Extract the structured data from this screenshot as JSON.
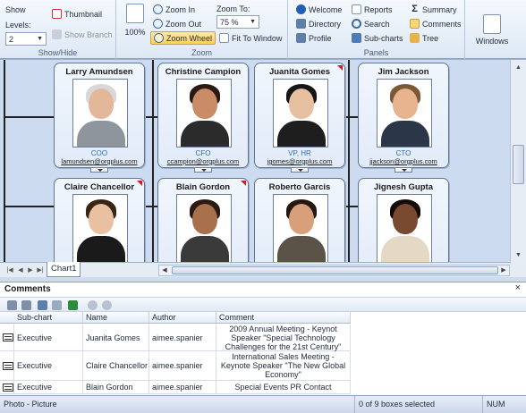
{
  "ribbon": {
    "show_hide": {
      "show_label": "Show",
      "levels_label": "Levels:",
      "show_value": "2",
      "levels_value": "2",
      "thumbnail_label": "Thumbnail",
      "show_branch_label": "Show Branch",
      "group_label": "Show/Hide"
    },
    "zoom": {
      "zoom_100_label": "100%",
      "zoom_in_label": "Zoom In",
      "zoom_out_label": "Zoom Out",
      "zoom_wheel_label": "Zoom Wheel",
      "zoom_to_label": "Zoom To:",
      "zoom_to_value": "75 %",
      "fit_to_window_label": "Fit To Window",
      "group_label": "Zoom"
    },
    "panels": {
      "welcome_label": "Welcome",
      "directory_label": "Directory",
      "profile_label": "Profile",
      "reports_label": "Reports",
      "search_label": "Search",
      "subcharts_label": "Sub-charts",
      "summary_label": "Summary",
      "comments_label": "Comments",
      "tree_label": "Tree",
      "group_label": "Panels"
    },
    "windows_label": "Windows"
  },
  "chart": {
    "cards": [
      {
        "name": "Larry Amundsen",
        "title": "COO",
        "email": "lamundsen@orgplus.com",
        "flag": false,
        "skin": "#e2b79a",
        "hair": "#d8d8d8",
        "shirt": "#8f959c"
      },
      {
        "name": "Christine Campion",
        "title": "CFO",
        "email": "ccampion@orgplus.com",
        "flag": false,
        "skin": "#c98c67",
        "hair": "#2a1a12",
        "shirt": "#2b2b2b"
      },
      {
        "name": "Juanita Gomes",
        "title": "VP, HR",
        "email": "jgomes@orgplus.com",
        "flag": true,
        "skin": "#e6c0a0",
        "hair": "#151515",
        "shirt": "#1e1e1e"
      },
      {
        "name": "Jim Jackson",
        "title": "CTO",
        "email": "jjackson@orgplus.com",
        "flag": false,
        "skin": "#e7b48f",
        "hair": "#7a5a36",
        "shirt": "#2b3648"
      },
      {
        "name": "Claire Chancellor",
        "title": "",
        "email": "",
        "flag": true,
        "skin": "#e8c1a2",
        "hair": "#3a2414",
        "shirt": "#1a1a1a"
      },
      {
        "name": "Blain Gordon",
        "title": "",
        "email": "",
        "flag": true,
        "skin": "#a9704c",
        "hair": "#2a1a12",
        "shirt": "#3a3a3a"
      },
      {
        "name": "Roberto Garcis",
        "title": "",
        "email": "",
        "flag": false,
        "skin": "#d7a07a",
        "hair": "#241810",
        "shirt": "#5b5248"
      },
      {
        "name": "Jignesh Gupta",
        "title": "",
        "email": "",
        "flag": false,
        "skin": "#7a4a30",
        "hair": "#120c08",
        "shirt": "#e4d9c4"
      }
    ],
    "sheet_tab": "Chart1"
  },
  "comments_panel": {
    "title": "Comments",
    "close": "×",
    "columns": [
      "Sub-chart",
      "Name",
      "Author",
      "Comment"
    ],
    "rows": [
      {
        "subchart": "Executive",
        "name": "Juanita Gomes",
        "author": "aimee.spanier",
        "comment": "2009 Annual Meeting - Keynot Speaker \"Special Technology Challenges for the 21st Century\""
      },
      {
        "subchart": "Executive",
        "name": "Claire Chancellor",
        "author": "aimee.spanier",
        "comment": "International Sales Meeting - Keynote Speaker \"The New Global Economy\""
      },
      {
        "subchart": "Executive",
        "name": "Blain Gordon",
        "author": "aimee.spanier",
        "comment": "Special Events PR Contact"
      }
    ]
  },
  "statusbar": {
    "left": "Photo - Picture",
    "selection": "0 of 9 boxes selected",
    "num": "NUM"
  },
  "colors": {
    "accent": "#2e6db4",
    "flag": "#d21b1b",
    "active_button": "#ffd05a"
  }
}
